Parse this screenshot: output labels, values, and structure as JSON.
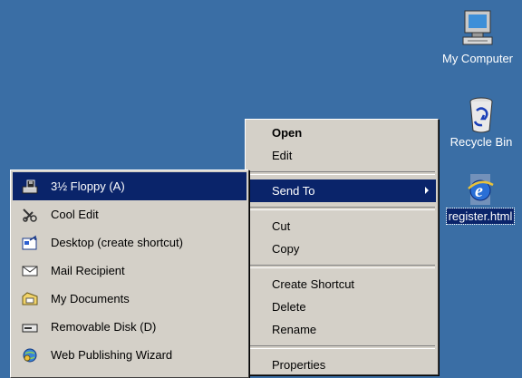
{
  "desktop": {
    "icons": [
      {
        "name": "My Computer",
        "icon": "computer-icon"
      },
      {
        "name": "Recycle Bin",
        "icon": "recycle-bin-icon"
      },
      {
        "name": "register.html",
        "icon": "ie-html-file-icon",
        "selected": true
      }
    ]
  },
  "context_menu": {
    "items": [
      "Open",
      "Edit",
      "Send To",
      "Cut",
      "Copy",
      "Create Shortcut",
      "Delete",
      "Rename",
      "Properties"
    ],
    "default_item": "Open",
    "highlighted_item": "Send To"
  },
  "send_to_menu": {
    "items": [
      {
        "label": "3½ Floppy (A)",
        "icon": "floppy-drive-icon"
      },
      {
        "label": "Cool Edit",
        "icon": "cool-edit-icon"
      },
      {
        "label": "Desktop (create shortcut)",
        "icon": "desktop-shortcut-icon"
      },
      {
        "label": "Mail Recipient",
        "icon": "mail-envelope-icon"
      },
      {
        "label": "My Documents",
        "icon": "my-documents-folder-icon"
      },
      {
        "label": "Removable Disk (D)",
        "icon": "removable-disk-icon"
      },
      {
        "label": "Web Publishing Wizard",
        "icon": "web-publishing-wizard-icon"
      }
    ],
    "highlighted_item": "3½ Floppy (A)"
  },
  "colors": {
    "desktop": "#3a6ea5",
    "menu": "#d4d0c8",
    "highlight": "#0a246a"
  }
}
